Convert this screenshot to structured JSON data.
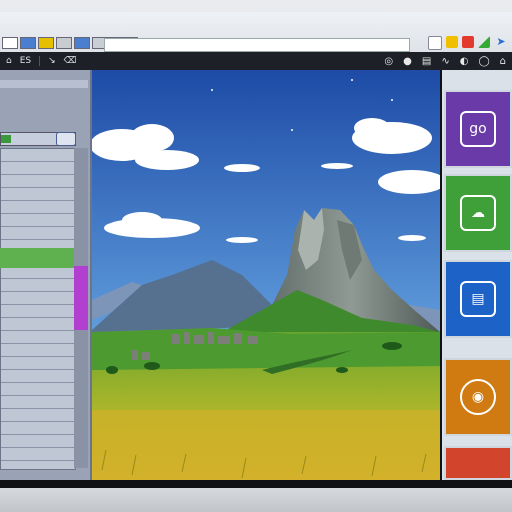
{
  "topbar": {
    "address": "",
    "tab_labels": [
      "",
      "",
      ""
    ]
  },
  "cmdbar": {
    "left_items": [
      "⌂",
      "ES",
      "↘",
      "⌫"
    ],
    "right_items": [
      "◎",
      "●",
      "▤",
      "∿",
      "◐",
      "◯",
      "⌂"
    ]
  },
  "left_panel": {
    "tag": "",
    "rows": 24
  },
  "tiles": [
    {
      "name": "go-tile",
      "label": "go",
      "color": "#6a3aa8"
    },
    {
      "name": "cloud-tile",
      "label": "☁",
      "color": "#3fa03a"
    },
    {
      "name": "doc-tile",
      "label": "▤",
      "color": "#1d62c7"
    },
    {
      "name": "music-tile",
      "label": "◉",
      "color": "#d07a12"
    },
    {
      "name": "photo-tile",
      "label": "",
      "color": "#d3442d"
    }
  ],
  "colors": {
    "sky_top": "#1f4fa8",
    "sky_bottom": "#8cc0e8",
    "grass": "#5a9a2a",
    "field": "#c8b02a"
  }
}
